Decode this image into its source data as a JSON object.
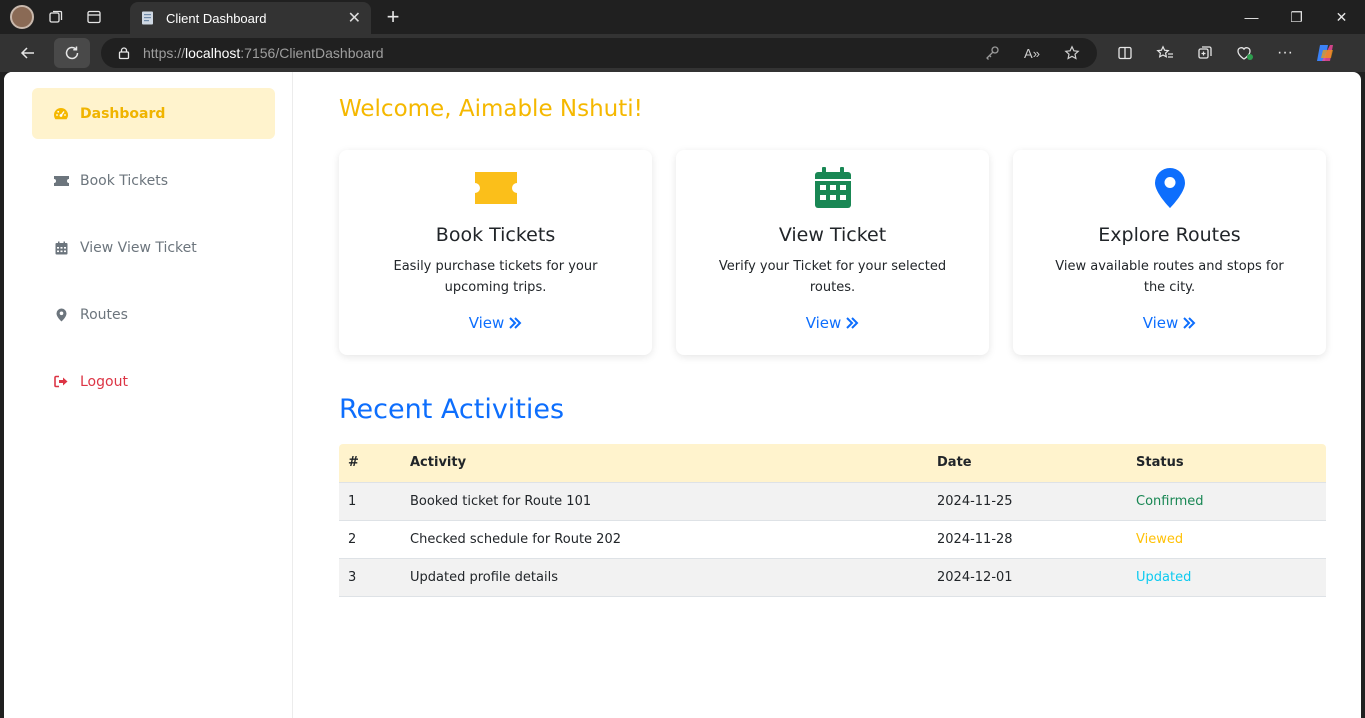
{
  "browser": {
    "tab_title": "Client Dashboard",
    "url_scheme": "https://",
    "url_host": "localhost",
    "url_rest": ":7156/ClientDashboard"
  },
  "sidebar": {
    "items": [
      {
        "label": "Dashboard",
        "icon": "gauge-icon"
      },
      {
        "label": "Book Tickets",
        "icon": "ticket-icon"
      },
      {
        "label": "View View Ticket",
        "icon": "calendar-icon"
      },
      {
        "label": "Routes",
        "icon": "map-pin-icon"
      },
      {
        "label": "Logout",
        "icon": "sign-out-icon"
      }
    ]
  },
  "main": {
    "welcome": "Welcome, Aimable Nshuti!",
    "cards": [
      {
        "title": "Book Tickets",
        "desc": "Easily purchase tickets for your upcoming trips.",
        "link": "View",
        "icon": "ticket-icon",
        "color": "#fbbf1a"
      },
      {
        "title": "View Ticket",
        "desc": "Verify your Ticket for your selected routes.",
        "link": "View",
        "icon": "calendar-icon",
        "color": "#198754"
      },
      {
        "title": "Explore Routes",
        "desc": "View available routes and stops for the city.",
        "link": "View",
        "icon": "map-pin-icon",
        "color": "#0d6efd"
      }
    ],
    "recent_title": "Recent Activities",
    "table": {
      "headers": [
        "#",
        "Activity",
        "Date",
        "Status"
      ],
      "rows": [
        {
          "num": "1",
          "activity": "Booked ticket for Route 101",
          "date": "2024-11-25",
          "status": "Confirmed",
          "status_color": "#198754"
        },
        {
          "num": "2",
          "activity": "Checked schedule for Route 202",
          "date": "2024-11-28",
          "status": "Viewed",
          "status_color": "#ffc107"
        },
        {
          "num": "3",
          "activity": "Updated profile details",
          "date": "2024-12-01",
          "status": "Updated",
          "status_color": "#0dcaf0"
        }
      ]
    }
  },
  "colors": {
    "accent": "#f5b800",
    "active_bg": "#fff3cd",
    "link": "#0d6efd",
    "danger": "#dc3545"
  }
}
